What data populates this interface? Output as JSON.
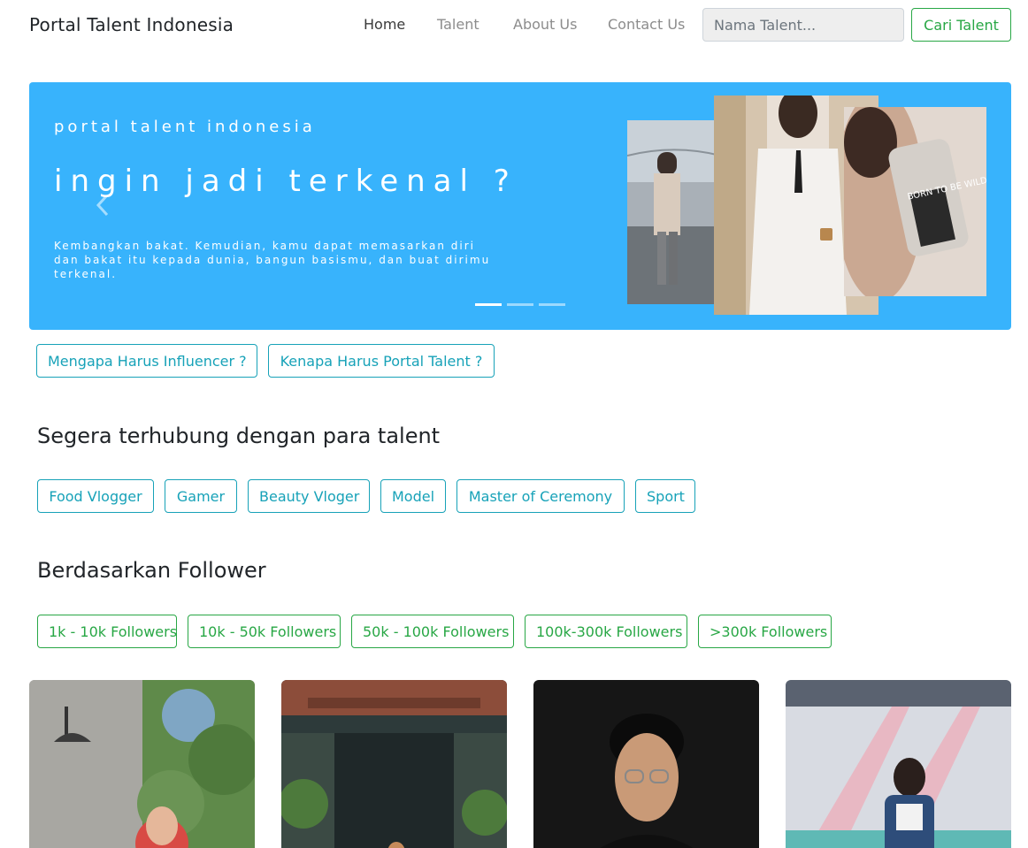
{
  "navbar": {
    "brand": "Portal Talent Indonesia",
    "links": [
      {
        "label": "Home",
        "active": true
      },
      {
        "label": "Talent",
        "active": false
      },
      {
        "label": "About Us",
        "active": false
      },
      {
        "label": "Contact Us",
        "active": false
      }
    ],
    "search_placeholder": "Nama Talent...",
    "search_button": "Cari Talent"
  },
  "hero": {
    "kicker": "portal talent indonesia",
    "title": "ingin jadi terkenal ?",
    "text": "Kembangkan bakat. Kemudian, kamu dapat memasarkan diri dan bakat itu kepada dunia, bangun basismu, dan buat dirimu terkenal.",
    "active_slide_index": 0,
    "slide_count": 3,
    "background_color": "#38b3fc",
    "phone_case_text": "BORN TO BE WILDE"
  },
  "info_buttons": [
    "Mengapa Harus Influencer ?",
    "Kenapa Harus Portal Talent ?"
  ],
  "categories": {
    "title": "Segera terhubung dengan para talent",
    "items": [
      "Food Vlogger",
      "Gamer",
      "Beauty Vloger",
      "Model",
      "Master of Ceremony",
      "Sport"
    ]
  },
  "followers": {
    "title": "Berdasarkan Follower",
    "items": [
      "1k - 10k Followers",
      "10k - 50k Followers",
      "50k - 100k Followers",
      "100k-300k Followers",
      ">300k Followers"
    ]
  },
  "talent_cards": [
    "talent-photo-1",
    "talent-photo-2",
    "talent-photo-3",
    "talent-photo-4"
  ],
  "colors": {
    "accent_info": "#17a2b8",
    "accent_success": "#28a745"
  }
}
